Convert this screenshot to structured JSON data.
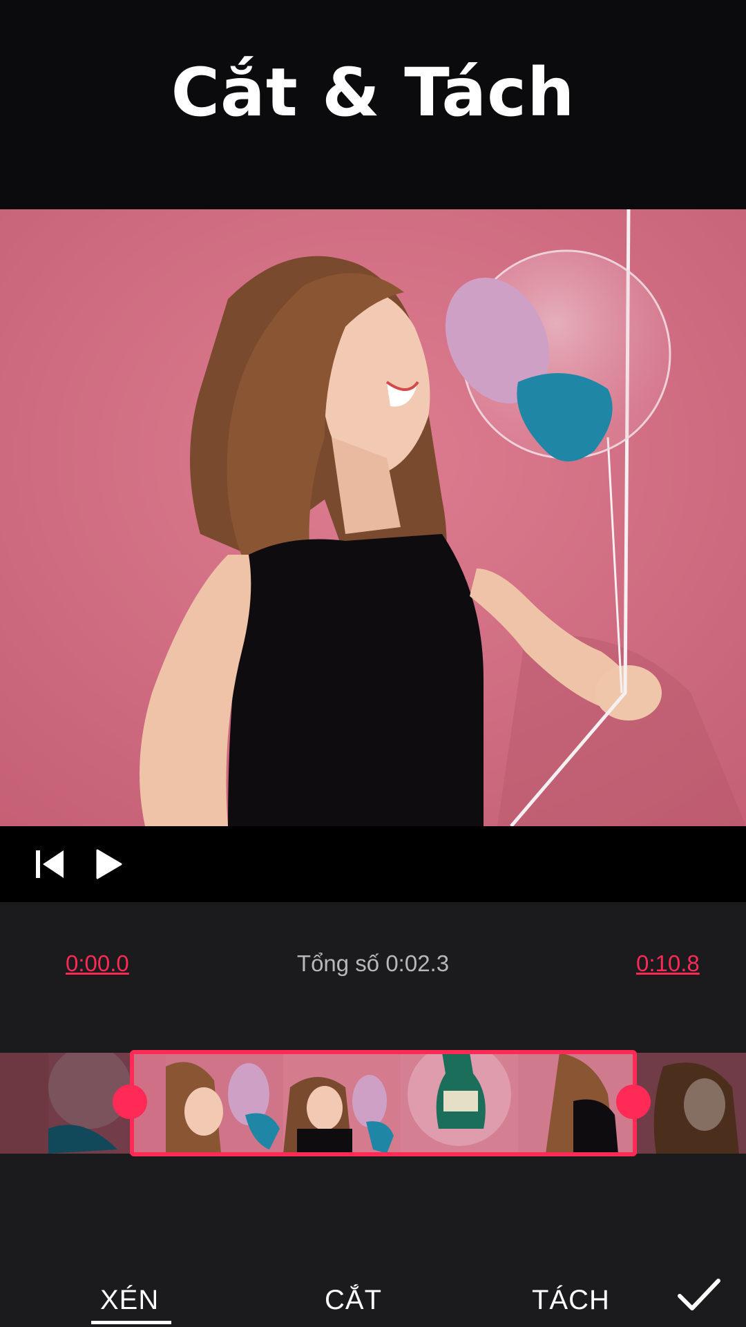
{
  "header": {
    "title": "Cắt & Tách"
  },
  "player": {
    "skip_start_icon": "skip-to-start-icon",
    "play_icon": "play-icon"
  },
  "trim": {
    "start_time": "0:00.0",
    "total_label": "Tổng số 0:02.3",
    "end_time": "0:10.8"
  },
  "tabs": [
    {
      "label": "XÉN",
      "selected": true
    },
    {
      "label": "CẮT",
      "selected": false
    },
    {
      "label": "TÁCH",
      "selected": false
    }
  ],
  "confirm_icon": "check-icon",
  "colors": {
    "accent": "#ff2a55",
    "background": "#0b0a0d",
    "panel": "#1b1a1d"
  }
}
